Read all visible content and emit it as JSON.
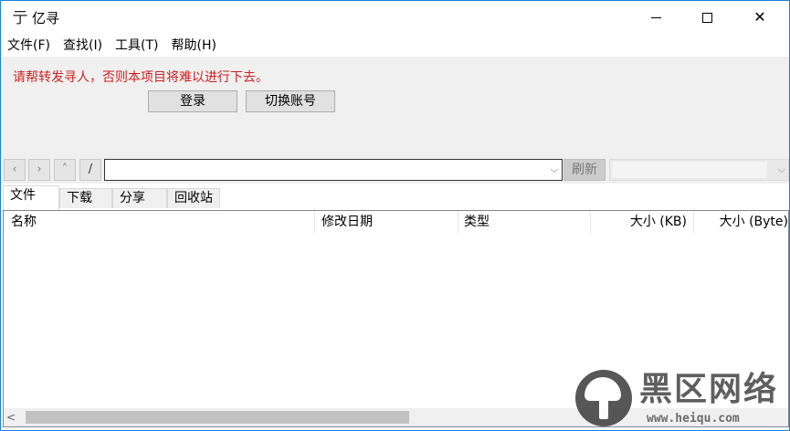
{
  "window": {
    "title": "亿寻",
    "icon": "亍",
    "controls": {
      "minimize": "minimize-icon",
      "maximize": "maximize-icon",
      "close": "✕"
    }
  },
  "menu": [
    "文件(F)",
    "查找(I)",
    "工具(T)",
    "帮助(H)"
  ],
  "login_panel": {
    "notice": "请帮转发寻人，否则本项目将难以进行下去。",
    "login_label": "登录",
    "switch_account_label": "切换账号",
    "notice_color": "#d11f1f"
  },
  "navbar": {
    "back": "‹",
    "forward": "›",
    "up": "˄",
    "root": "/",
    "path_value": "",
    "combo_arrow": "⌵",
    "refresh_label": "刷新",
    "account_value": "",
    "account_arrow": "⌵"
  },
  "tabs": [
    "文件",
    "下载",
    "分享",
    "回收站"
  ],
  "list": {
    "columns": [
      "名称",
      "修改日期",
      "类型",
      "大小 (KB)",
      "大小 (Byte)"
    ],
    "rows": []
  },
  "scrollbar": {
    "left_arrow": "<"
  },
  "watermark": {
    "title": "黑区网络",
    "url": "www.heiqu.com"
  }
}
